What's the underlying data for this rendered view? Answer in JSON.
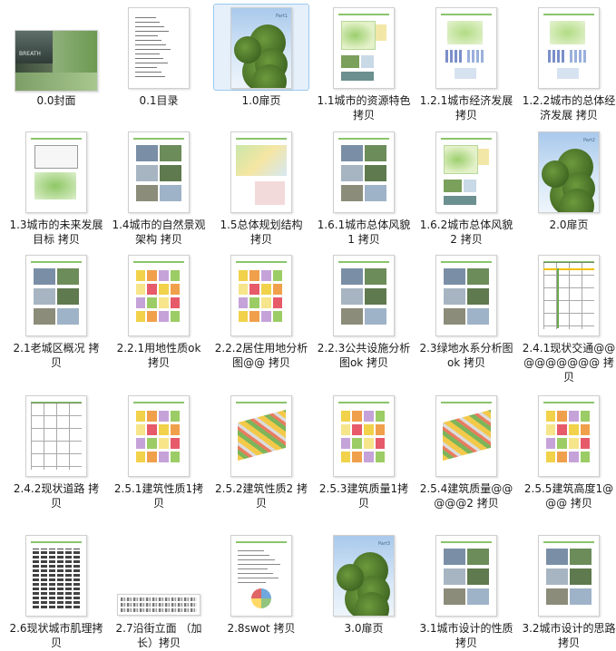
{
  "items": [
    {
      "label": "0.0封面",
      "thumb": "cover"
    },
    {
      "label": "0.1目录",
      "thumb": "toc"
    },
    {
      "label": "1.0扉页",
      "thumb": "title-page"
    },
    {
      "label": "1.1城市的资源特色 拷贝",
      "thumb": "map-page"
    },
    {
      "label": "1.2.1城市经济发展 拷贝",
      "thumb": "chart-page"
    },
    {
      "label": "1.2.2城市的总体经济发展 拷贝",
      "thumb": "chart-page"
    },
    {
      "label": "1.3城市的未来发展目标 拷贝",
      "thumb": "diagram-page"
    },
    {
      "label": "1.4城市的自然景观架构 拷贝",
      "thumb": "photo-page"
    },
    {
      "label": "1.5总体规划结构 拷贝",
      "thumb": "plan-page"
    },
    {
      "label": "1.6.1城市总体风貌1 拷贝",
      "thumb": "photo-page"
    },
    {
      "label": "1.6.2城市总体风貌2 拷贝",
      "thumb": "map-page"
    },
    {
      "label": "2.0扉页",
      "thumb": "title-page"
    },
    {
      "label": "2.1老城区概况 拷贝",
      "thumb": "photo-page"
    },
    {
      "label": "2.2.1用地性质ok 拷贝",
      "thumb": "landuse-page"
    },
    {
      "label": "2.2.2居住用地分析图@@ 拷贝",
      "thumb": "landuse-page"
    },
    {
      "label": "2.2.3公共设施分析图ok 拷贝",
      "thumb": "photo-page"
    },
    {
      "label": "2.3绿地水系分析图ok 拷贝",
      "thumb": "photo-page"
    },
    {
      "label": "2.4.1现状交通@@@@@@@@@ 拷贝",
      "thumb": "grid-page"
    },
    {
      "label": "2.4.2现状道路 拷贝",
      "thumb": "road-page"
    },
    {
      "label": "2.5.1建筑性质1拷贝",
      "thumb": "landuse-page"
    },
    {
      "label": "2.5.2建筑性质2 拷贝",
      "thumb": "axo-page"
    },
    {
      "label": "2.5.3建筑质量1拷贝",
      "thumb": "landuse-page"
    },
    {
      "label": "2.5.4建筑质量@@@@@2 拷贝",
      "thumb": "axo-page"
    },
    {
      "label": "2.5.5建筑高度1@@@ 拷贝",
      "thumb": "landuse-page"
    },
    {
      "label": "2.6现状城市肌理拷贝",
      "thumb": "texture-page"
    },
    {
      "label": "2.7沿街立面 （加长）拷贝",
      "thumb": "elevation"
    },
    {
      "label": "2.8swot 拷贝",
      "thumb": "swot-page"
    },
    {
      "label": "3.0扉页",
      "thumb": "title-page"
    },
    {
      "label": "3.1城市设计的性质 拷贝",
      "thumb": "photo-page"
    },
    {
      "label": "3.2城市设计的思路 拷贝",
      "thumb": "photo-page"
    }
  ],
  "selected_index": 2,
  "title_page_badges": [
    "Part1",
    "Part2",
    "Part3"
  ],
  "cover_text": "BREATH"
}
